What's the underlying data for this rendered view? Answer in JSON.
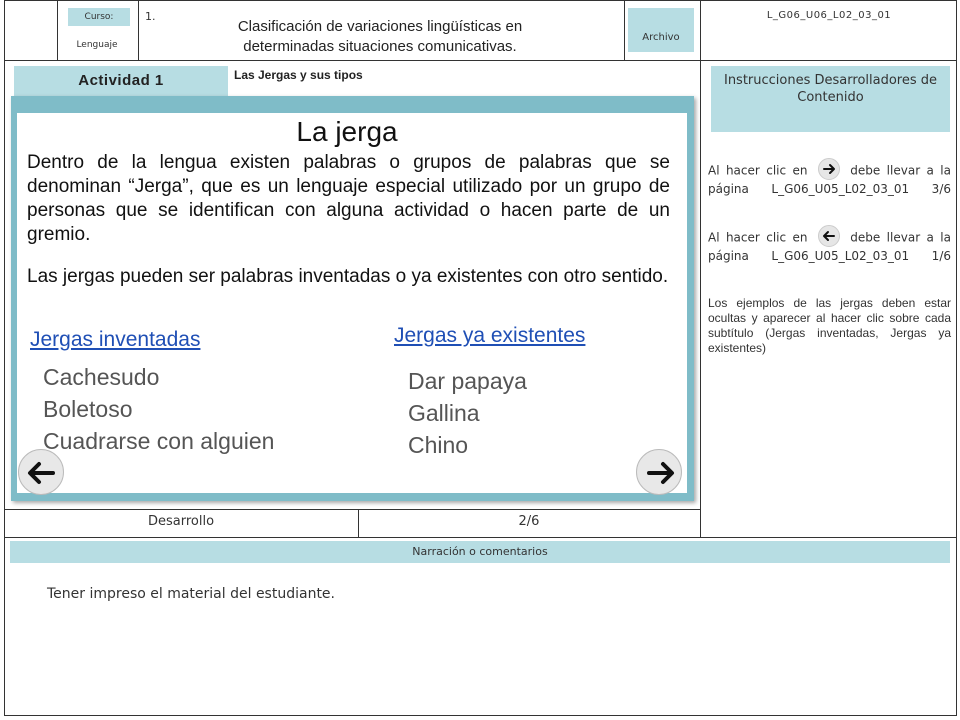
{
  "header": {
    "course_label": "Curso:",
    "subject": "Lenguaje",
    "grade_number": "1.",
    "title_line1": "Clasificación de variaciones lingüísticas en",
    "title_line2": "determinadas situaciones comunicativas.",
    "archive_label": "Archivo",
    "file_code": "L_G06_U06_L02_03_01"
  },
  "activity": {
    "badge": "Actividad 1",
    "topic": "Las Jergas y sus tipos"
  },
  "slide": {
    "title": "La jerga",
    "paragraph1": "Dentro de la lengua existen palabras o grupos de palabras que se denominan “Jerga”, que es un lenguaje especial utilizado por un grupo de personas que se identifican con alguna actividad o hacen parte de un gremio.",
    "paragraph2": "Las jergas pueden ser palabras inventadas o ya existentes con otro sentido.",
    "invented": {
      "heading": "Jergas inventadas",
      "items": [
        "Cachesudo",
        "Boletoso",
        "Cuadrarse con alguien"
      ]
    },
    "existing": {
      "heading": "Jergas ya existentes",
      "items": [
        "Dar papaya",
        "Gallina",
        "Chino"
      ]
    },
    "prev_icon": "arrow-left-icon",
    "next_icon": "arrow-right-icon"
  },
  "instructions": {
    "heading": "Instrucciones Desarrolladores de Contenido",
    "next_note_prefix": "Al hacer clic en",
    "next_note_suffix": "debe llevar a la página L_G06_U05_L02_03_01 3/6",
    "prev_note_prefix": "Al hacer clic en",
    "prev_note_suffix": "debe llevar a la página L_G06_U05_L02_03_01 1/6",
    "examples_note": "Los ejemplos de las jergas deben estar ocultas y aparecer al hacer clic sobre cada subtítulo (Jergas inventadas, Jergas ya existentes)"
  },
  "footer": {
    "stage": "Desarrollo",
    "page": "2/6"
  },
  "narration": {
    "label": "Narración o comentarios",
    "text": "Tener impreso el material del estudiante."
  }
}
